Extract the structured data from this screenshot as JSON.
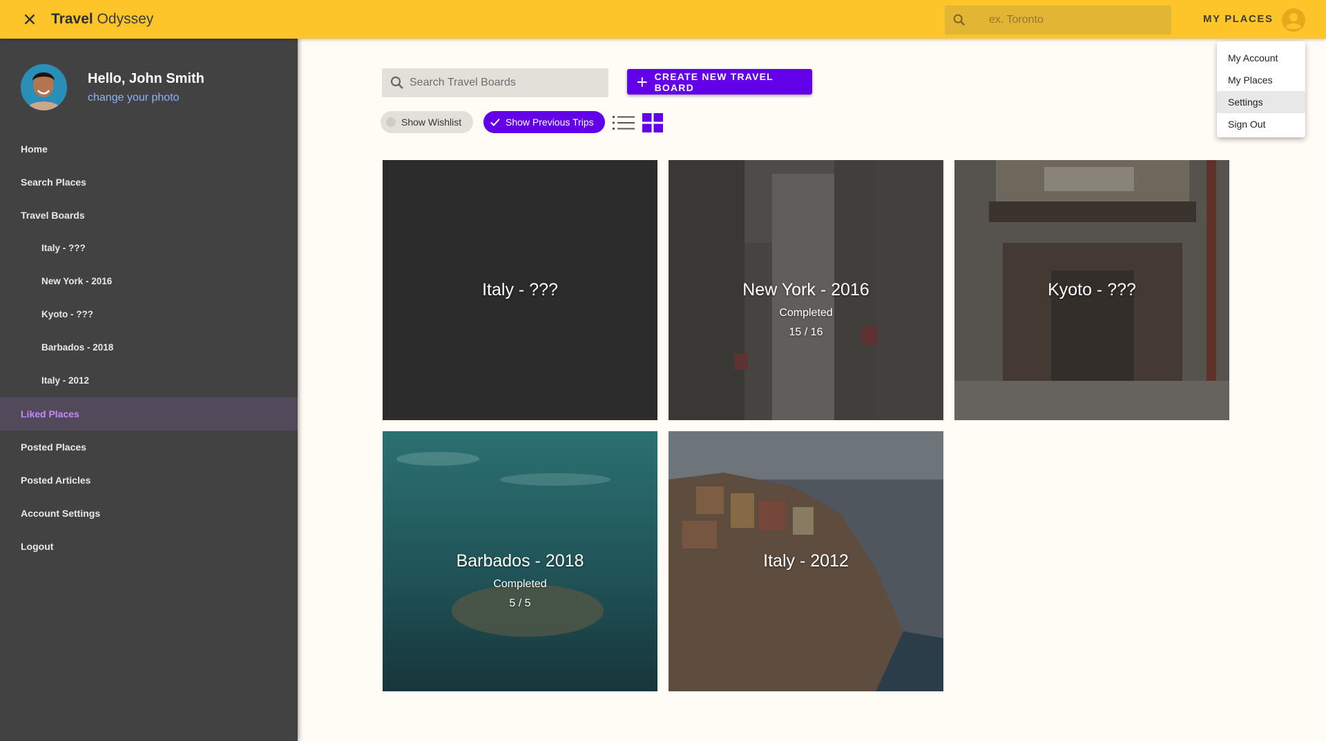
{
  "topbar": {
    "title_bold": "Travel",
    "title_rest": " Odyssey",
    "search_placeholder": "ex. Toronto",
    "my_places_label": "MY PLACES"
  },
  "dropdown": {
    "items": [
      "My Account",
      "My Places",
      "Settings",
      "Sign Out"
    ]
  },
  "sidebar": {
    "greeting": "Hello, John Smith",
    "change_photo": "change your photo",
    "nav": [
      {
        "label": "Home"
      },
      {
        "label": "Search Places"
      },
      {
        "label": "Travel Boards"
      },
      {
        "label": "Italy - ???"
      },
      {
        "label": "New York - 2016"
      },
      {
        "label": "Kyoto - ???"
      },
      {
        "label": "Barbados - 2018"
      },
      {
        "label": "Italy - 2012"
      },
      {
        "label": "Liked Places"
      },
      {
        "label": "Posted Places"
      },
      {
        "label": "Posted Articles"
      },
      {
        "label": "Account Settings"
      },
      {
        "label": "Logout"
      }
    ]
  },
  "main": {
    "search_placeholder": "Search Travel Boards",
    "create_label": "CREATE NEW TRAVEL BOARD",
    "chip_wishlist": "Show Wishlist",
    "chip_previous": "Show Previous Trips",
    "cards": [
      {
        "title": "Italy - ???",
        "status": "",
        "count": ""
      },
      {
        "title": "New York - 2016",
        "status": "Completed",
        "count": "15 / 16"
      },
      {
        "title": "Kyoto - ???",
        "status": "",
        "count": ""
      },
      {
        "title": "Barbados - 2018",
        "status": "Completed",
        "count": "5 / 5"
      },
      {
        "title": "Italy - 2012",
        "status": "",
        "count": ""
      }
    ]
  },
  "colors": {
    "topbar": "#fec52a",
    "sidebar": "#424242",
    "accent": "#6200ea",
    "active_nav": "#c58af9",
    "background": "#fffcf5"
  }
}
